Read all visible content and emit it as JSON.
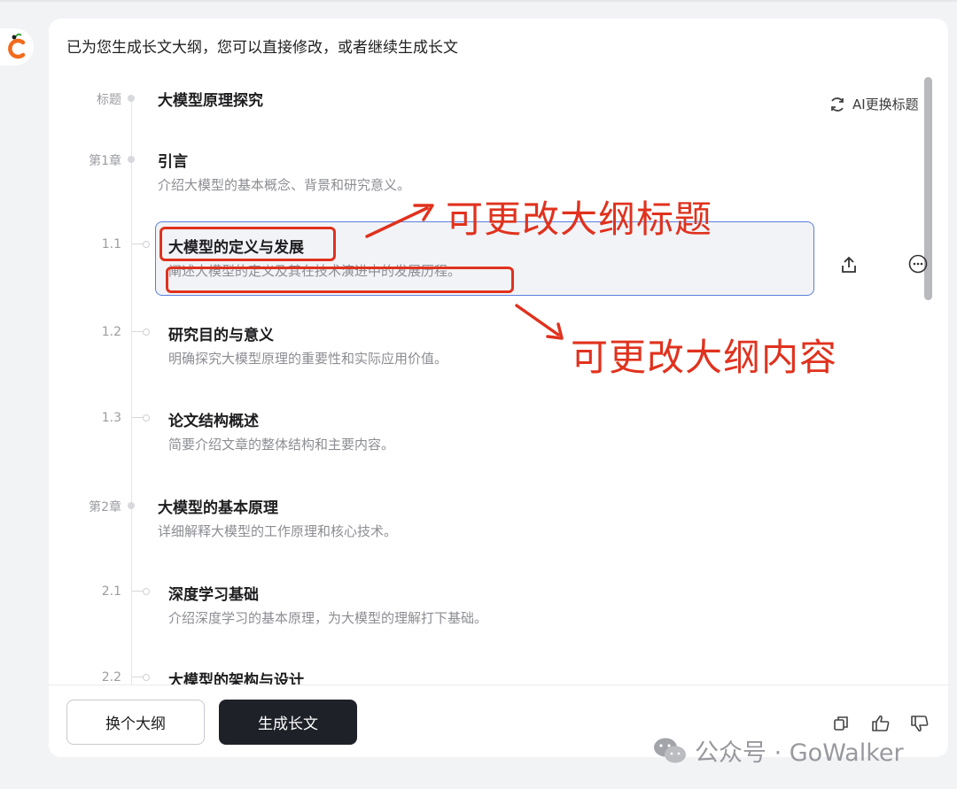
{
  "intro_text": "已为您生成长文大纲，您可以直接修改，或者继续生成长文",
  "ai_title_button": "AI更换标题",
  "outline": {
    "title": {
      "label": "标题",
      "text": "大模型原理探究"
    },
    "items": [
      {
        "label": "第1章",
        "title": "引言",
        "desc": "介绍大模型的基本概念、背景和研究意义。"
      },
      {
        "label": "1.1",
        "title": "大模型的定义与发展",
        "desc": "阐述大模型的定义及其在技术演进中的发展历程。"
      },
      {
        "label": "1.2",
        "title": "研究目的与意义",
        "desc": "明确探究大模型原理的重要性和实际应用价值。"
      },
      {
        "label": "1.3",
        "title": "论文结构概述",
        "desc": "简要介绍文章的整体结构和主要内容。"
      },
      {
        "label": "第2章",
        "title": "大模型的基本原理",
        "desc": "详细解释大模型的工作原理和核心技术。"
      },
      {
        "label": "2.1",
        "title": "深度学习基础",
        "desc": "介绍深度学习的基本原理，为大模型的理解打下基础。"
      },
      {
        "label": "2.2",
        "title": "大模型的架构与设计",
        "desc": ""
      }
    ]
  },
  "buttons": {
    "change_outline": "换个大纲",
    "generate_article": "生成长文"
  },
  "annotations": {
    "title_note": "可更改大纲标题",
    "content_note": "可更改大纲内容"
  },
  "watermark": "公众号 · GoWalker",
  "colors": {
    "accent_orange": "#f26b1d",
    "annotation_red": "#e0321e",
    "selection_blue": "#5b7fe0",
    "primary_dark": "#1f2129"
  }
}
